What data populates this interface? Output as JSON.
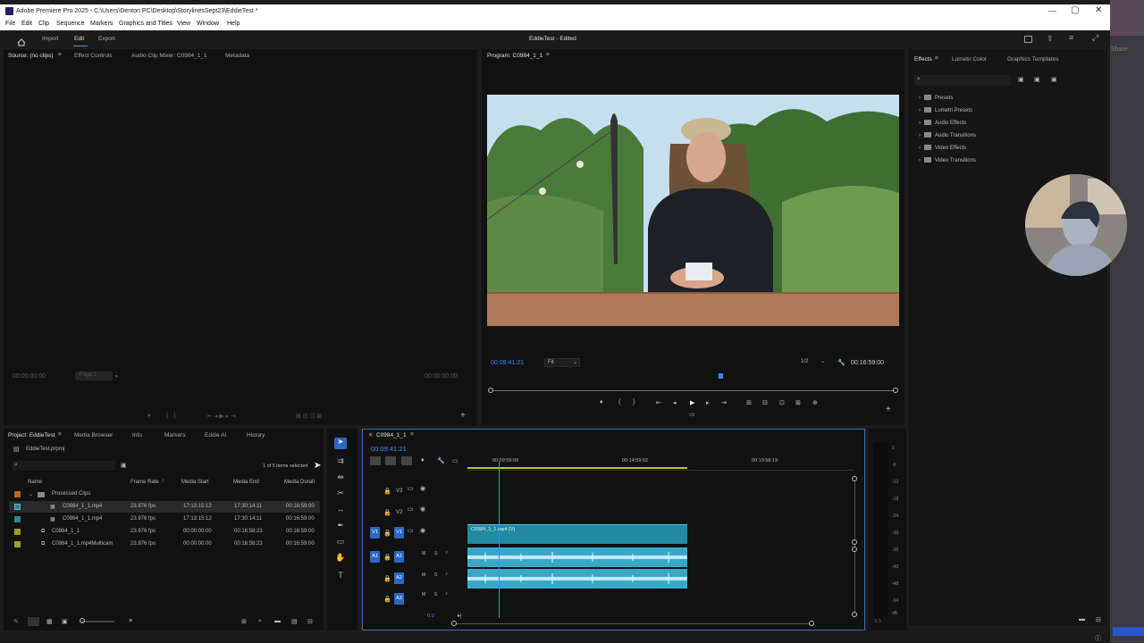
{
  "window": {
    "title": "Adobe Premiere Pro 2025 - C:\\Users\\Denton PC\\Desktop\\StorylinesSept23\\EddieTest *",
    "controls": [
      "—",
      "▢",
      "✕"
    ]
  },
  "menu": [
    "File",
    "Edit",
    "Clip",
    "Sequence",
    "Markers",
    "Graphics and Titles",
    "View",
    "Window",
    "Help"
  ],
  "header": {
    "workspaces": [
      "Import",
      "Edit",
      "Export"
    ],
    "project_title": "EddieTest - Edited"
  },
  "source_panel": {
    "tabs": [
      "Source: (no clips)",
      "Effect Controls",
      "Audio Clip Mixer: C0984_1_1",
      "Metadata"
    ],
    "timecode_left": "00:00:00:00",
    "page": "Page 1",
    "timecode_right": "00:00:00:00"
  },
  "program_panel": {
    "tab": "Program: C0984_1_1",
    "timecode": "00:09:41:21",
    "fit": "Fit",
    "resolution": "1/2",
    "duration": "00:16:59:00"
  },
  "effects_panel": {
    "tabs": [
      "Effects",
      "Lumetri Color",
      "Graphics Templates"
    ],
    "items": [
      "Presets",
      "Lumetri Presets",
      "Audio Effects",
      "Audio Transitions",
      "Video Effects",
      "Video Transitions"
    ]
  },
  "project_panel": {
    "tabs": [
      "Project: EddieTest",
      "Media Browser",
      "Info",
      "Markers",
      "Eddie AI",
      "History"
    ],
    "file": "EddieTest.prproj",
    "selection": "1 of 5 items selected",
    "columns": [
      "Name",
      "Frame Rate",
      "Media Start",
      "Media End",
      "Media Durati"
    ],
    "rows": [
      {
        "name": "Processed Clips",
        "fps": "",
        "start": "",
        "end": "",
        "dur": "",
        "color": "#c8601a"
      },
      {
        "name": "C0984_1_1.mp4",
        "fps": "23.976 fps",
        "start": "17:13:15:12",
        "end": "17:30:14:11",
        "dur": "00:16:59:00",
        "color": "#2a8a8a"
      },
      {
        "name": "C0984_1_1.mp4",
        "fps": "23.976 fps",
        "start": "17:13:15:12",
        "end": "17:30:14:11",
        "dur": "00:16:59:00",
        "color": "#2a8a8a"
      },
      {
        "name": "C0984_1_1",
        "fps": "23.976 fps",
        "start": "00:00:00:00",
        "end": "00:16:58:23",
        "dur": "00:16:59:00",
        "color": "#a0a020"
      },
      {
        "name": "C0984_1_1.mp4Multicam",
        "fps": "23.976 fps",
        "start": "00:00:00:00",
        "end": "00:16:58:23",
        "dur": "00:16:59:00",
        "color": "#a0a020"
      }
    ]
  },
  "timeline": {
    "tab": "C0984_1_1",
    "timecode": "00:09:41:21",
    "ruler": [
      "00:09:59:09",
      "00:14:59:02",
      "00:19:58:19"
    ],
    "video_tracks": [
      "V3",
      "V2",
      "V1"
    ],
    "audio_tracks": [
      "A1",
      "A2",
      "A3"
    ],
    "clip_label": "C0984_1_1.mp4 [V]",
    "audio_mix": "0.0"
  },
  "meter": {
    "scale": [
      "0",
      "-6",
      "-12",
      "-18",
      "-24",
      "-30",
      "-36",
      "-42",
      "-48",
      "-54",
      "dB"
    ]
  },
  "right_edge": {
    "share": "Share"
  },
  "colors": {
    "accent": "#3d8cf5",
    "clip_video": "#1f8aa0",
    "clip_audio": "#39a7c9",
    "label_folder": "#c8601a"
  }
}
